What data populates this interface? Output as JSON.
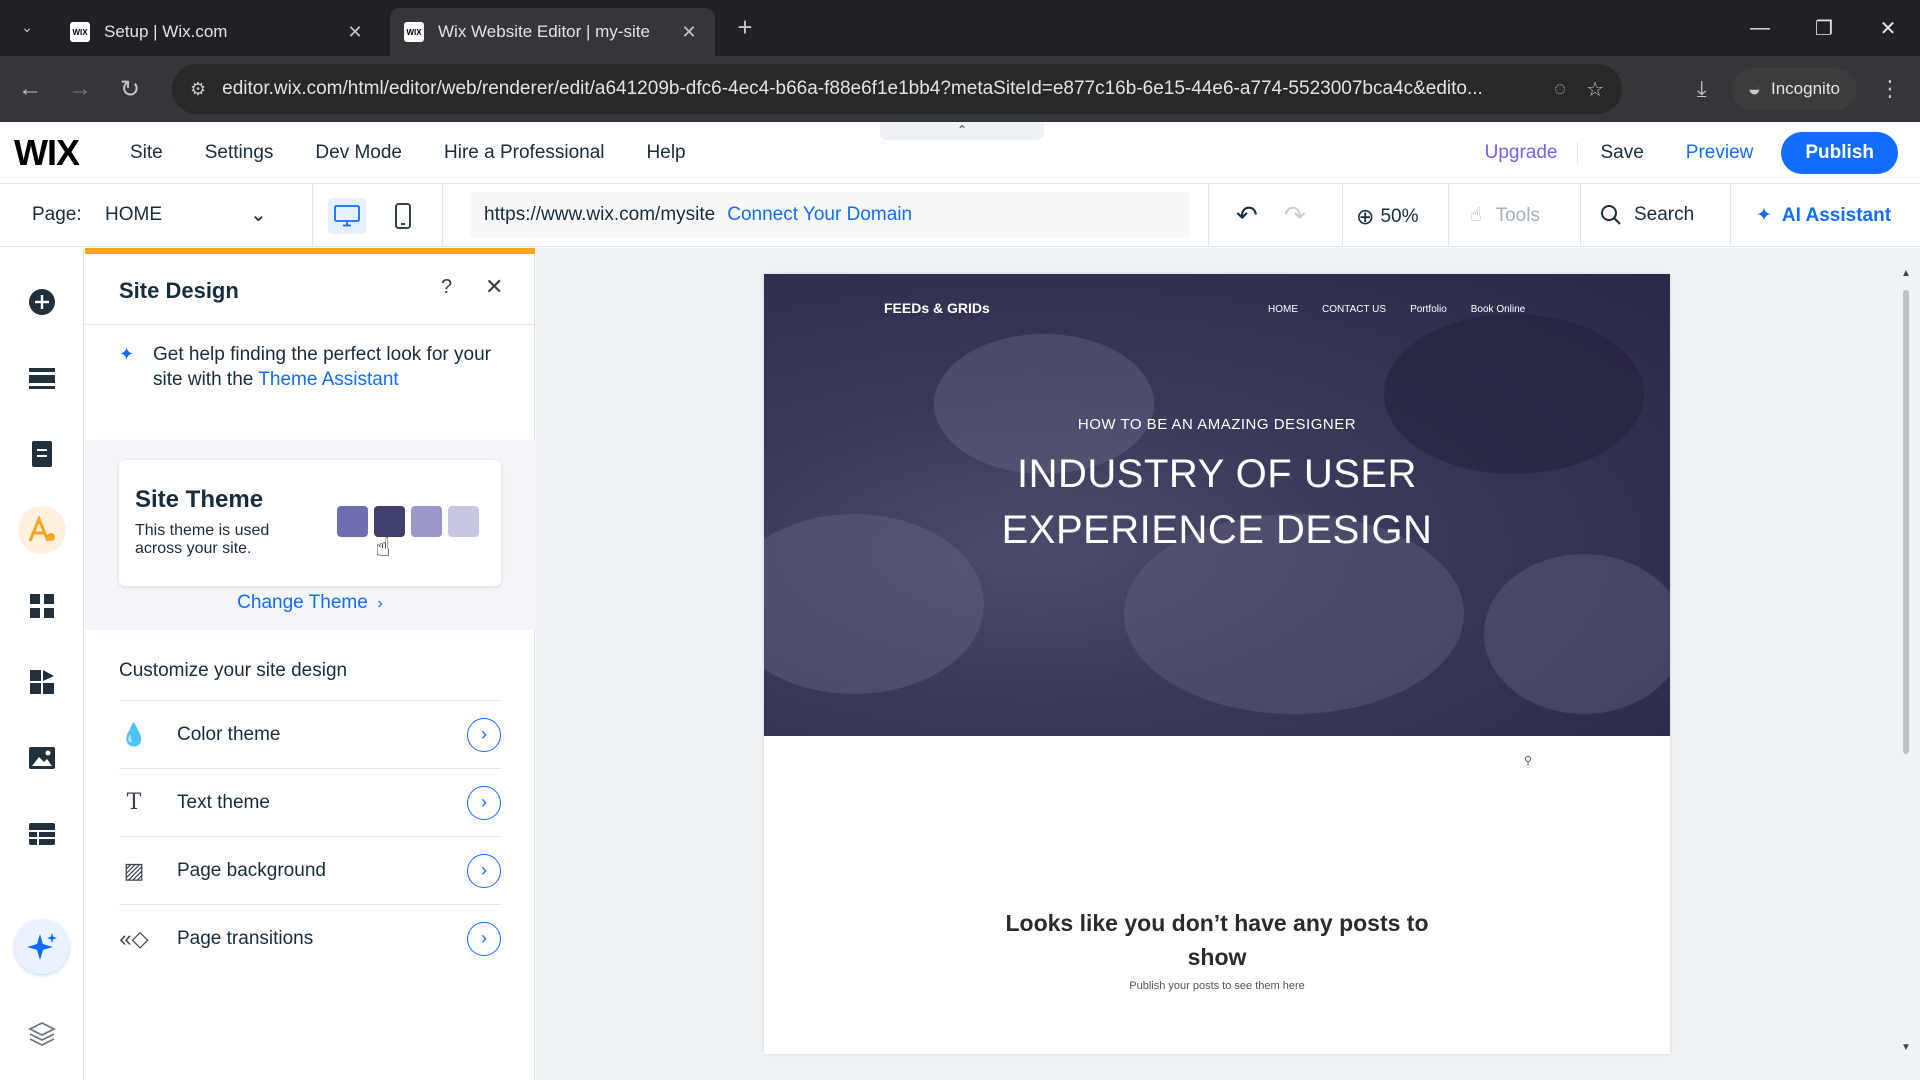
{
  "browser": {
    "tabs": [
      {
        "title": "Setup | Wix.com",
        "favicon": "WIX",
        "active": false
      },
      {
        "title": "Wix Website Editor | my-site",
        "favicon": "WIX",
        "active": true
      }
    ],
    "url": "editor.wix.com/html/editor/web/renderer/edit/a641209b-dfc6-4ec4-b66a-f88e6f1e1bb4?metaSiteId=e877c16b-6e15-44e6-a774-5523007bca4c&edito...",
    "incognito_label": "Incognito"
  },
  "editor": {
    "logo": "WIX",
    "menu": [
      "Site",
      "Settings",
      "Dev Mode",
      "Hire a Professional",
      "Help"
    ],
    "actions": {
      "upgrade": "Upgrade",
      "save": "Save",
      "preview": "Preview",
      "publish": "Publish"
    },
    "toolbar": {
      "page_label": "Page:",
      "page_name": "HOME",
      "site_url": "https://www.wix.com/mysite",
      "connect_domain": "Connect Your Domain",
      "zoom": "50%",
      "tools": "Tools",
      "search": "Search",
      "ai_assistant": "AI Assistant"
    },
    "rail_icons": [
      "add-elements-icon",
      "sections-icon",
      "pages-icon",
      "site-design-icon",
      "apps-icon",
      "business-apps-icon",
      "media-icon",
      "cms-icon",
      "ai-tools-icon",
      "layers-icon"
    ]
  },
  "panel": {
    "title": "Site Design",
    "tip_text": "Get help finding the perfect look for your site with the ",
    "tip_link": "Theme Assistant",
    "theme": {
      "title": "Site Theme",
      "description": "This theme is used across your site.",
      "swatches": [
        "#6e6eb0",
        "#3f3f6b",
        "#9a98c6",
        "#c8c7e2"
      ]
    },
    "change_theme": "Change Theme",
    "customize_title": "Customize your site design",
    "options": [
      {
        "label": "Color theme",
        "icon": "color-drop-icon"
      },
      {
        "label": "Text theme",
        "icon": "text-icon"
      },
      {
        "label": "Page background",
        "icon": "background-icon"
      },
      {
        "label": "Page transitions",
        "icon": "transitions-icon"
      }
    ]
  },
  "site": {
    "logo": "FEEDs & GRIDs",
    "nav": [
      "HOME",
      "CONTACT US",
      "Portfolio",
      "Book Online"
    ],
    "hero_subtitle": "HOW TO BE AN AMAZING DESIGNER",
    "hero_title": "INDUSTRY OF USER EXPERIENCE DESIGN",
    "empty_title": "Looks like you don’t have any posts to show",
    "empty_subtitle": "Publish your posts to see them here"
  }
}
